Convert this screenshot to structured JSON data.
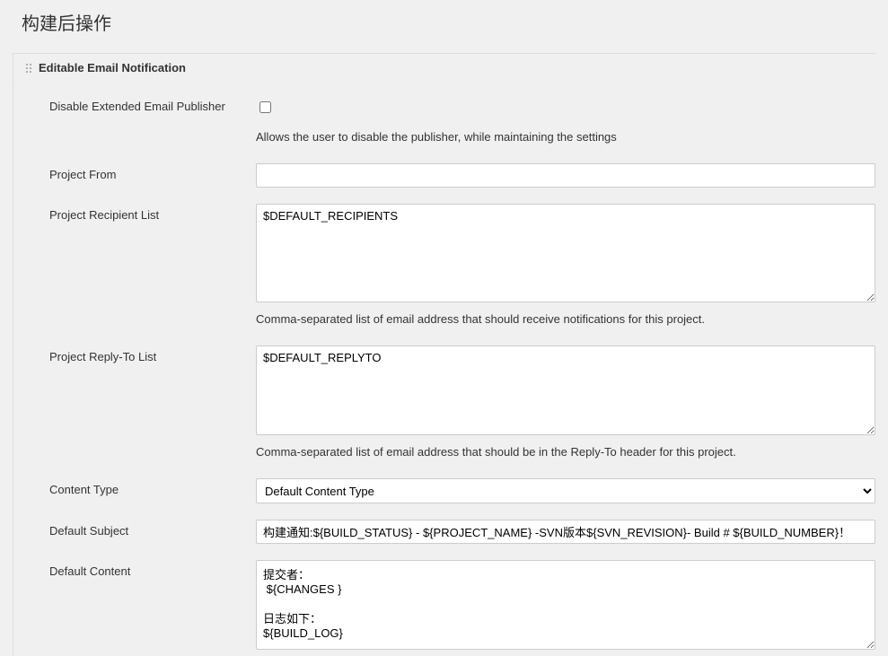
{
  "header": {
    "title": "构建后操作"
  },
  "section": {
    "title": "Editable Email Notification",
    "fields": {
      "disable_publisher": {
        "label": "Disable Extended Email Publisher",
        "checked": false,
        "help": "Allows the user to disable the publisher, while maintaining the settings"
      },
      "project_from": {
        "label": "Project From",
        "value": ""
      },
      "recipient_list": {
        "label": "Project Recipient List",
        "value": "$DEFAULT_RECIPIENTS",
        "help": "Comma-separated list of email address that should receive notifications for this project."
      },
      "reply_to_list": {
        "label": "Project Reply-To List",
        "value": "$DEFAULT_REPLYTO",
        "help": "Comma-separated list of email address that should be in the Reply-To header for this project."
      },
      "content_type": {
        "label": "Content Type",
        "selected": "Default Content Type"
      },
      "default_subject": {
        "label": "Default Subject",
        "value": "构建通知:${BUILD_STATUS} - ${PROJECT_NAME} -SVN版本${SVN_REVISION}- Build # ${BUILD_NUMBER}！"
      },
      "default_content": {
        "label": "Default Content",
        "value": "提交者：\n ${CHANGES }\n\n日志如下：\n${BUILD_LOG}"
      }
    }
  }
}
